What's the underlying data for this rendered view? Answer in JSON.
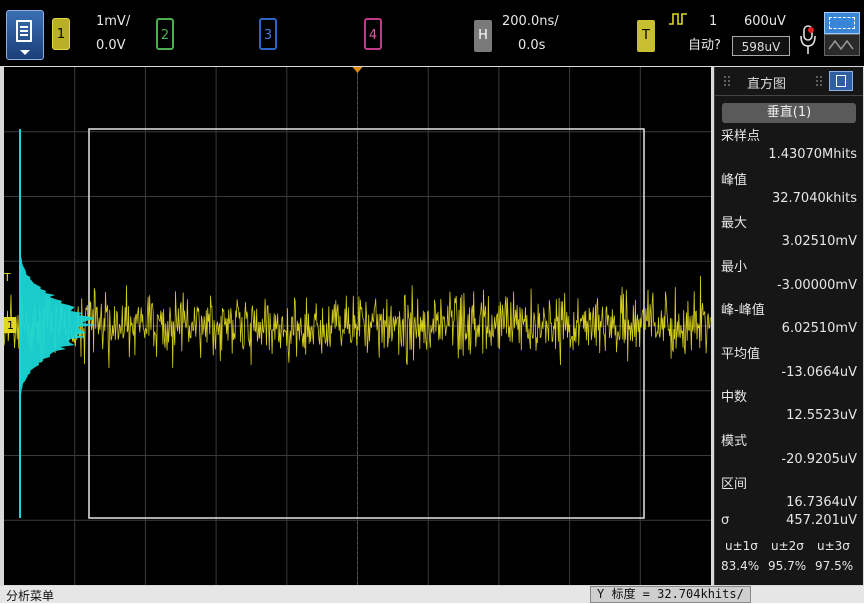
{
  "top_bar": {
    "menu_icon": "menu-icon",
    "channels": [
      {
        "number": "1",
        "color": "#c9c034"
      },
      {
        "number": "2",
        "color": "#4caf50"
      },
      {
        "number": "3",
        "color": "#2d64c8"
      },
      {
        "number": "4",
        "color": "#c03b86"
      }
    ],
    "ch1_scale": "1mV/",
    "ch1_offset": "0.0V",
    "horizontal_label": "H",
    "time_per_div": "200.0ns/",
    "time_delay": "0.0s",
    "trigger_label": "T",
    "trigger_source": "1",
    "trigger_level": "600uV",
    "trigger_mode": "自动?",
    "trigger_level_box": "598uV"
  },
  "screen": {
    "trace_color": "#e0d820",
    "histogram_color": "#1ad6d6",
    "grid_color": "#3a3a3a",
    "window_color": "#d8d8d8",
    "markers": {
      "trigger": "T",
      "ground": "1"
    }
  },
  "panel": {
    "title": "直方图",
    "vertical_tab": "垂直(1)",
    "stats": [
      {
        "label": "采样点",
        "value": "1.43070Mhits"
      },
      {
        "label": "峰值",
        "value": "32.7040khits"
      },
      {
        "label": "最大",
        "value": "3.02510mV"
      },
      {
        "label": "最小",
        "value": "-3.00000mV"
      },
      {
        "label": "峰-峰值",
        "value": "6.02510mV"
      },
      {
        "label": "平均值",
        "value": "-13.0664uV"
      },
      {
        "label": "中数",
        "value": "12.5523uV"
      },
      {
        "label": "模式",
        "value": "-20.9205uV"
      },
      {
        "label": "区间",
        "value": "16.7364uV"
      }
    ],
    "sigma_label": "σ",
    "sigma_value": "457.201uV",
    "sigma_headers": [
      "u±1σ",
      "u±2σ",
      "u±3σ"
    ],
    "sigma_percents": [
      "83.4%",
      "95.7%",
      "97.5%"
    ]
  },
  "bottom_bar": {
    "left_label": "分析菜单",
    "scale_label": "Y 标度 = 32.704khits/"
  }
}
